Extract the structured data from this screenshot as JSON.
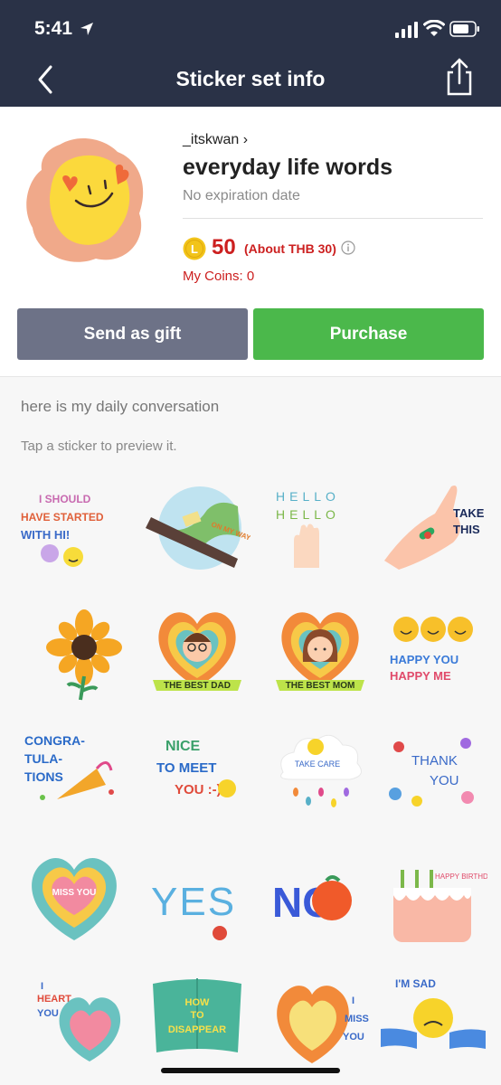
{
  "status_bar": {
    "time": "5:41"
  },
  "nav": {
    "title": "Sticker set info"
  },
  "sticker_set": {
    "author": "_itskwan",
    "title": "everyday life words",
    "expiry": "No expiration date",
    "price": "50",
    "price_local": "(About THB 30)",
    "coin_letter": "L",
    "my_coins": "My Coins: 0"
  },
  "buttons": {
    "gift": "Send as gift",
    "purchase": "Purchase"
  },
  "description": "here is my daily conversation",
  "preview_hint": "Tap a sticker to preview it.",
  "stickers": {
    "s1": {
      "line1": "I SHOULD",
      "line2": "HAVE STARTED",
      "line3": "WITH HI!"
    },
    "s2": {
      "text": "ON MY WAY"
    },
    "s3": {
      "line1": "HELLO",
      "line2": "HELLO"
    },
    "s4": {
      "line1": "TAKE",
      "line2": "THIS"
    },
    "s6": {
      "text": "THE BEST DAD"
    },
    "s7": {
      "text": "THE BEST MOM"
    },
    "s8": {
      "line1": "HAPPY YOU",
      "line2": "HAPPY ME"
    },
    "s9": {
      "line1": "CONGRA-",
      "line2": "TULA-",
      "line3": "TIONS"
    },
    "s10": {
      "line1": "NICE",
      "line2": "TO MEET",
      "line3": "YOU :-)"
    },
    "s11": {
      "text": "TAKE CARE"
    },
    "s12": {
      "line1": "THANK",
      "line2": "YOU"
    },
    "s13": {
      "text": "MISS YOU"
    },
    "s14": {
      "text": "YES"
    },
    "s15": {
      "text": "NO"
    },
    "s16": {
      "text": "HAPPY BIRTHDAY"
    },
    "s17": {
      "line1": "I",
      "line2": "HEART",
      "line3": "YOU"
    },
    "s18": {
      "line1": "HOW",
      "line2": "TO",
      "line3": "DISAPPEAR"
    },
    "s19": {
      "line1": "I",
      "line2": "MISS",
      "line3": "YOU"
    },
    "s20": {
      "text": "I'M SAD"
    }
  },
  "colors": {
    "nav_bg": "#2a3247",
    "price_red": "#cc1f1f",
    "gift_button": "#6d7287",
    "purchase_button": "#4bb84b",
    "coin_gold": "#f2c41a"
  }
}
